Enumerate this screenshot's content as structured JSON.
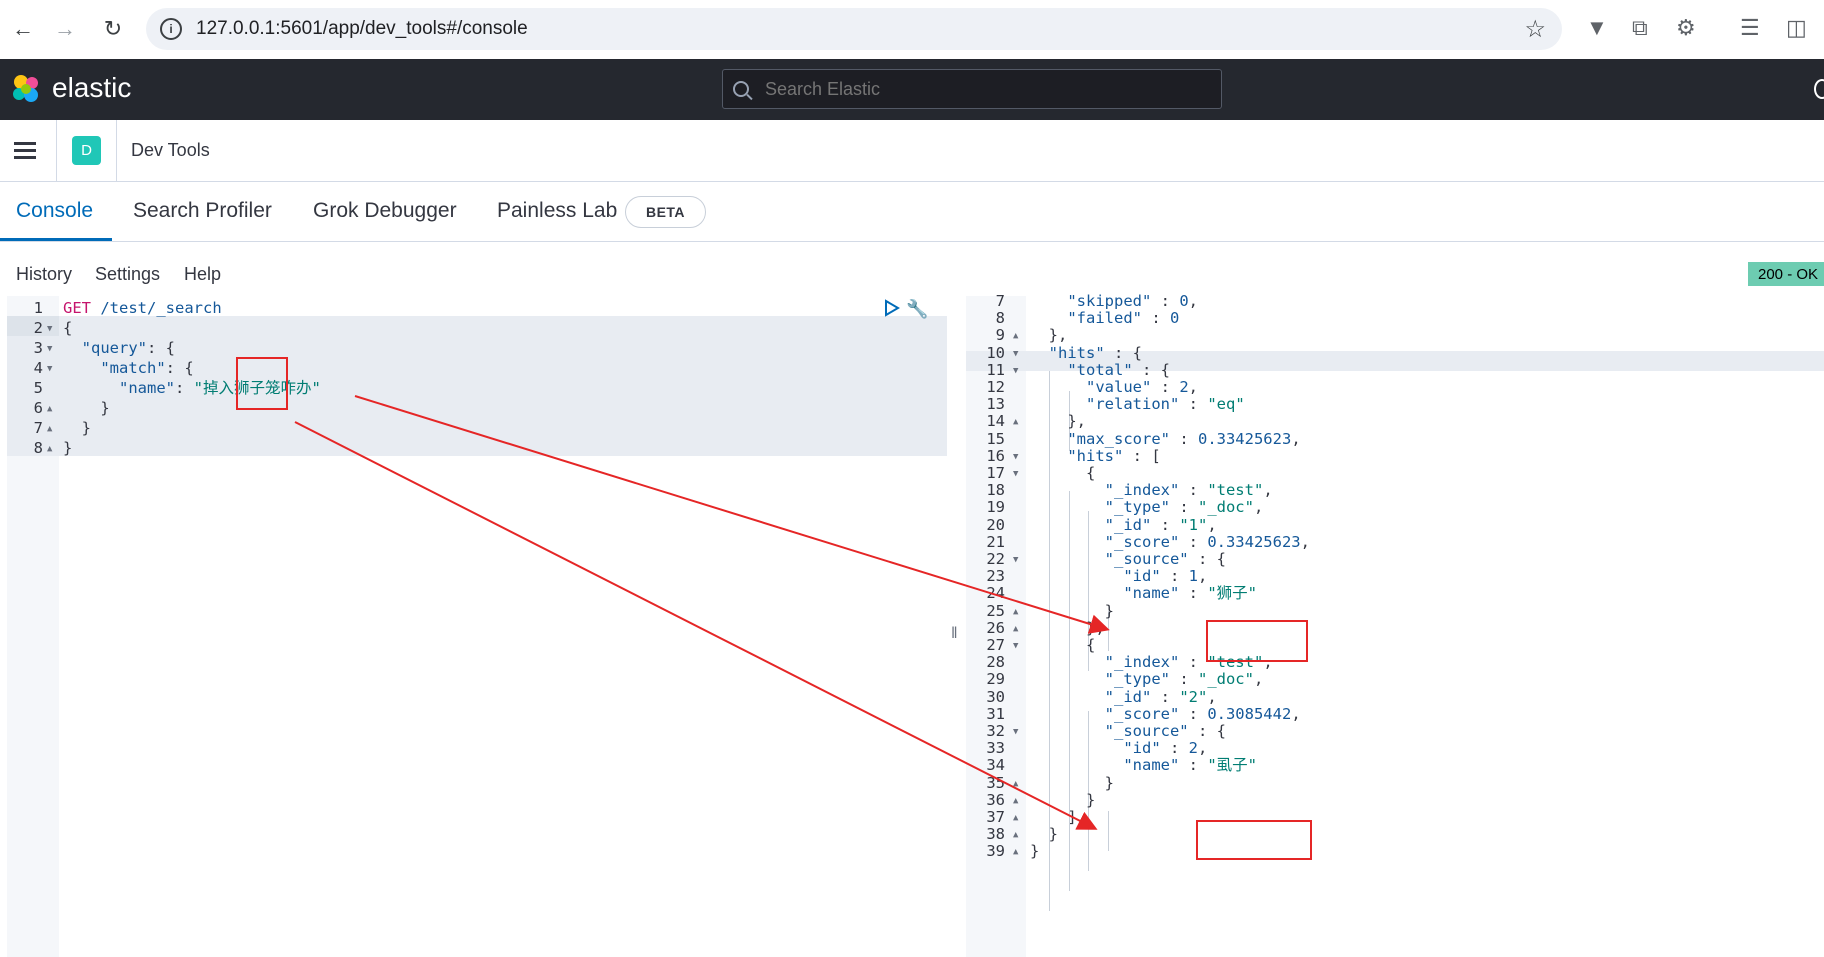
{
  "browser": {
    "url": "127.0.0.1:5601/app/dev_tools#/console"
  },
  "header": {
    "logo_text": "elastic",
    "search_placeholder": "Search Elastic"
  },
  "breadcrumb": {
    "avatar_letter": "D",
    "title": "Dev Tools"
  },
  "tabs": [
    {
      "label": "Console",
      "active": true
    },
    {
      "label": "Search Profiler"
    },
    {
      "label": "Grok Debugger"
    },
    {
      "label": "Painless Lab"
    }
  ],
  "beta_badge": "BETA",
  "console_menu": [
    "History",
    "Settings",
    "Help"
  ],
  "status_badge": "200 - OK",
  "request": {
    "method": "GET",
    "path": "/test/_search",
    "line_numbers": [
      "1",
      "2",
      "3",
      "4",
      "5",
      "6",
      "7",
      "8"
    ],
    "query_key": "\"query\"",
    "match_key": "\"match\"",
    "name_key": "\"name\"",
    "name_value": "\"掉入狮子笼咋办\""
  },
  "response": {
    "line_numbers": [
      "7",
      "8",
      "9",
      "10",
      "11",
      "12",
      "13",
      "14",
      "15",
      "16",
      "17",
      "18",
      "19",
      "20",
      "21",
      "22",
      "23",
      "24",
      "25",
      "26",
      "27",
      "28",
      "29",
      "30",
      "31",
      "32",
      "33",
      "34",
      "35",
      "36",
      "37",
      "38",
      "39"
    ],
    "lines": [
      "    \"skipped\" : 0,",
      "    \"failed\" : 0",
      "  },",
      "  \"hits\" : {",
      "    \"total\" : {",
      "      \"value\" : 2,",
      "      \"relation\" : \"eq\"",
      "    },",
      "    \"max_score\" : 0.33425623,",
      "    \"hits\" : [",
      "      {",
      "        \"_index\" : \"test\",",
      "        \"_type\" : \"_doc\",",
      "        \"_id\" : \"1\",",
      "        \"_score\" : 0.33425623,",
      "        \"_source\" : {",
      "          \"id\" : 1,",
      "          \"name\" : \"狮子\"",
      "        }",
      "      },",
      "      {",
      "        \"_index\" : \"test\",",
      "        \"_type\" : \"_doc\",",
      "        \"_id\" : \"2\",",
      "        \"_score\" : 0.3085442,",
      "        \"_source\" : {",
      "          \"id\" : 2,",
      "          \"name\" : \"虱子\"",
      "        }",
      "      }",
      "    ]",
      "  }",
      "}"
    ]
  }
}
